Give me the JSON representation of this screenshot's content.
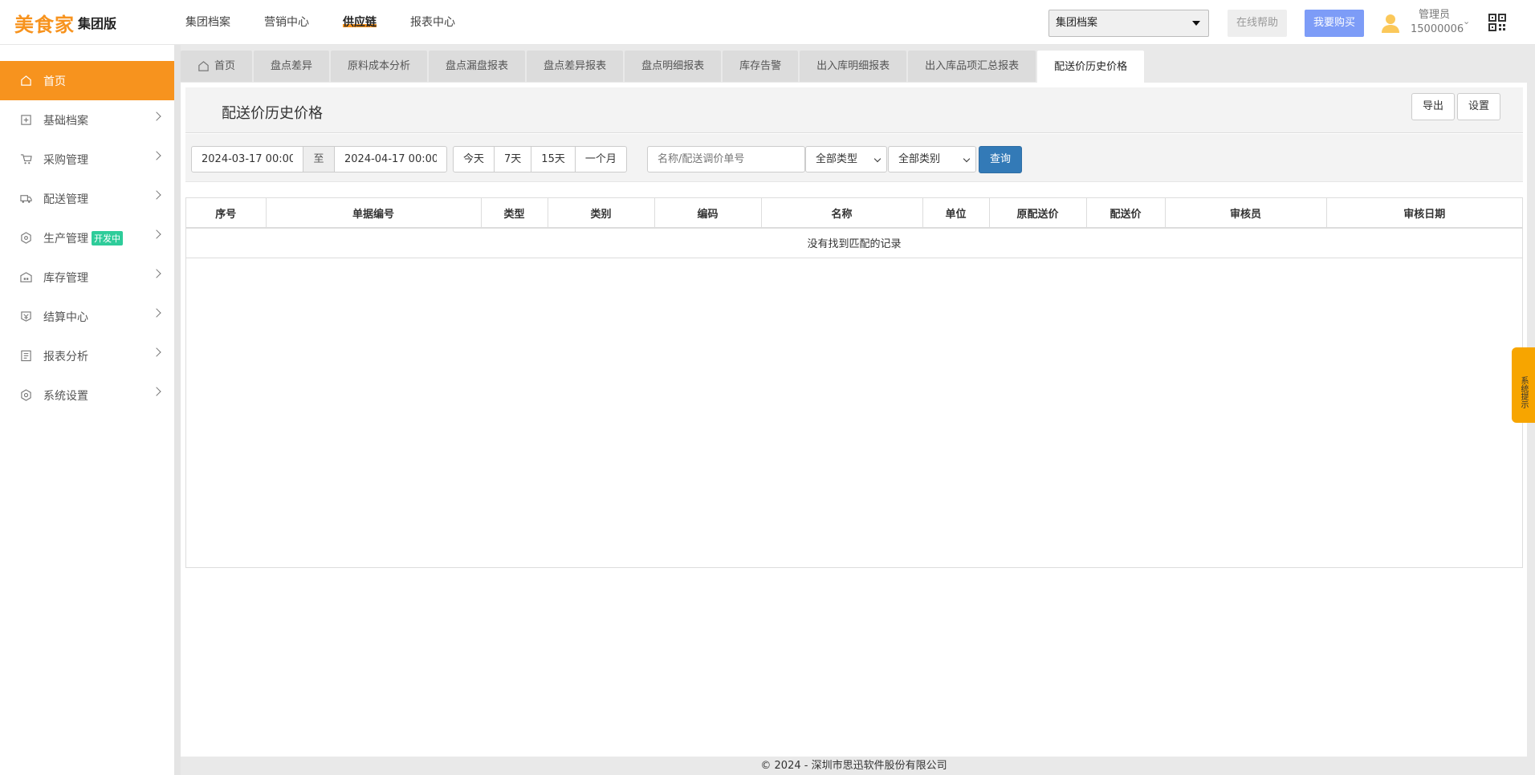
{
  "brand": {
    "name": "美食家",
    "edition": "集团版"
  },
  "top_nav": [
    {
      "label": "集团档案"
    },
    {
      "label": "营销中心"
    },
    {
      "label": "供应链"
    },
    {
      "label": "报表中心"
    }
  ],
  "top_nav_active": "供应链",
  "group_select": {
    "value": "集团档案"
  },
  "help_label": "在线帮助",
  "buy_label": "我要购买",
  "user": {
    "role": "管理员",
    "account": "15000006"
  },
  "sidebar": {
    "items": [
      {
        "label": "首页",
        "icon": "home-icon"
      },
      {
        "label": "基础档案",
        "icon": "archive-icon"
      },
      {
        "label": "采购管理",
        "icon": "cart-icon"
      },
      {
        "label": "配送管理",
        "icon": "truck-icon"
      },
      {
        "label": "生产管理",
        "icon": "production-icon",
        "badge": "开发中"
      },
      {
        "label": "库存管理",
        "icon": "warehouse-icon"
      },
      {
        "label": "结算中心",
        "icon": "settlement-icon"
      },
      {
        "label": "报表分析",
        "icon": "report-icon"
      },
      {
        "label": "系统设置",
        "icon": "settings-icon"
      }
    ]
  },
  "tabs": [
    {
      "label": "首页"
    },
    {
      "label": "盘点差异"
    },
    {
      "label": "原料成本分析"
    },
    {
      "label": "盘点漏盘报表"
    },
    {
      "label": "盘点差异报表"
    },
    {
      "label": "盘点明细报表"
    },
    {
      "label": "库存告警"
    },
    {
      "label": "出入库明细报表"
    },
    {
      "label": "出入库品项汇总报表"
    },
    {
      "label": "配送价历史价格"
    }
  ],
  "page": {
    "title": "配送价历史价格",
    "export_label": "导出",
    "settings_label": "设置"
  },
  "filters": {
    "start_date": "2024-03-17 00:00",
    "to_label": "至",
    "end_date": "2024-04-17 00:00",
    "quick_ranges": [
      "今天",
      "7天",
      "15天",
      "一个月"
    ],
    "search_placeholder": "名称/配送调价单号",
    "type_select": "全部类型",
    "category_select": "全部类别",
    "query_label": "查询"
  },
  "table": {
    "columns": [
      "序号",
      "单据编号",
      "类型",
      "类别",
      "编码",
      "名称",
      "单位",
      "原配送价",
      "配送价",
      "审核员",
      "审核日期"
    ],
    "empty_text": "没有找到匹配的记录"
  },
  "footer": "© 2024 - 深圳市思迅软件股份有限公司",
  "float_tip": "系统提示",
  "colors": {
    "accent": "#f7931e",
    "primary_button": "#337ab7",
    "buy_button": "#7d9cf7",
    "badge": "#2ecc9a"
  }
}
